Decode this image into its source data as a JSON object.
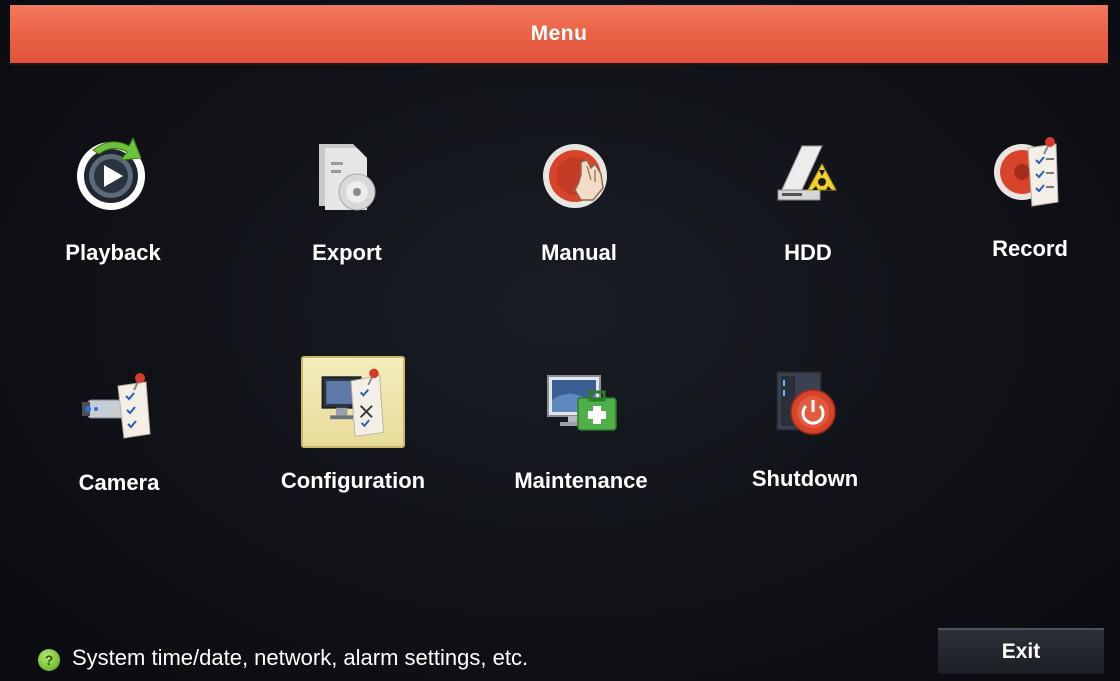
{
  "header": {
    "title": "Menu"
  },
  "menu_items": [
    {
      "label": "Playback",
      "icon": "playback-icon"
    },
    {
      "label": "Export",
      "icon": "export-icon"
    },
    {
      "label": "Manual",
      "icon": "manual-icon"
    },
    {
      "label": "HDD",
      "icon": "hdd-icon"
    },
    {
      "label": "Record",
      "icon": "record-icon"
    },
    {
      "label": "Camera",
      "icon": "camera-icon"
    },
    {
      "label": "Configuration",
      "icon": "configuration-icon",
      "selected": true
    },
    {
      "label": "Maintenance",
      "icon": "maintenance-icon"
    },
    {
      "label": "Shutdown",
      "icon": "shutdown-icon"
    }
  ],
  "status": {
    "help_text": "System time/date, network, alarm settings, etc.",
    "help_icon": "question-icon"
  },
  "footer": {
    "exit_label": "Exit"
  },
  "colors": {
    "title_bar": "#ec6448",
    "background": "#101218",
    "selected_tile": "#f4edbc",
    "help_icon": "#7bc23a"
  }
}
